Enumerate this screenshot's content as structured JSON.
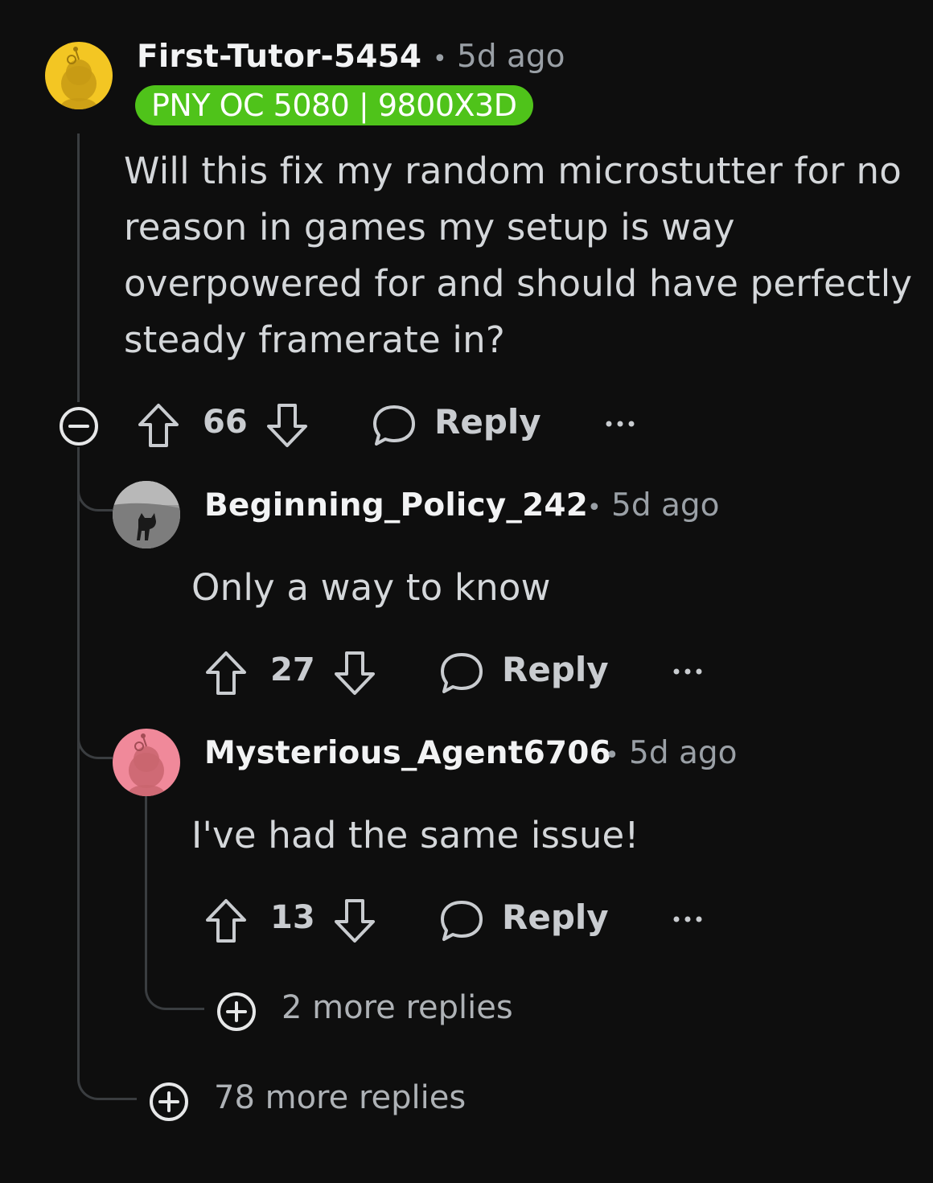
{
  "comments": [
    {
      "username": "First-Tutor-5454",
      "separator": "•",
      "time": "5d ago",
      "flair": "PNY OC 5080 | 9800X3D",
      "body": "Will this fix my random microstutter for no reason in games my setup is way overpowered for and should have perfectly steady framerate in?",
      "votes": "66",
      "reply_label": "Reply",
      "avatar_color": "#f3c623"
    },
    {
      "username": "Beginning_Policy_242",
      "separator": "•",
      "time": "5d ago",
      "body": "Only a way to know",
      "votes": "27",
      "reply_label": "Reply"
    },
    {
      "username": "Mysterious_Agent6706",
      "separator": "•",
      "time": "5d ago",
      "body": "I've had the same issue!",
      "votes": "13",
      "reply_label": "Reply",
      "avatar_color": "#f0899a"
    }
  ],
  "more_replies_nested": "2 more replies",
  "more_replies_top": "78 more replies",
  "colors": {
    "background": "#0e0e0e",
    "flair_bg": "#4fc31a",
    "thread_line": "#3a3d40"
  },
  "icons": [
    "collapse-icon",
    "upvote-icon",
    "downvote-icon",
    "comment-bubble-icon",
    "more-options-icon",
    "expand-plus-icon"
  ]
}
